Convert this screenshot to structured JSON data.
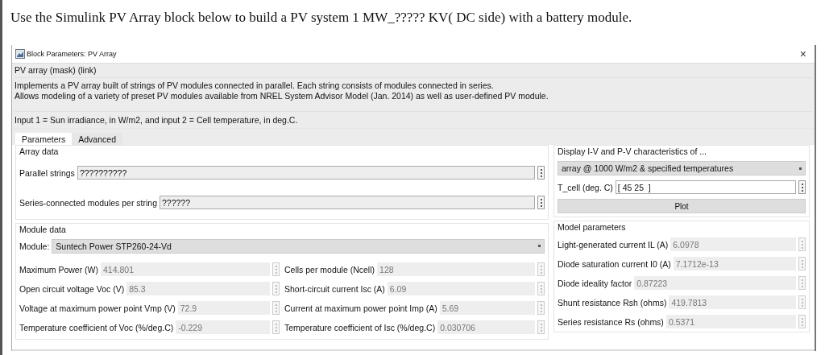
{
  "question": "Use the Simulink PV Array block below to build a PV system 1 MW_????? KV( DC side) with a battery module.",
  "dialog": {
    "title": "Block Parameters: PV Array",
    "close": "×",
    "mask_title": "PV array (mask) (link)",
    "description": [
      "Implements a PV array built of strings of PV modules connected in parallel. Each string consists of modules connected in series.",
      "Allows modeling of a variety of preset PV modules available from NREL System Advisor Model (Jan. 2014) as well as user-defined PV module."
    ],
    "input_note": "Input 1 = Sun irradiance, in W/m2, and input 2 = Cell temperature, in deg.C.",
    "tabs": [
      {
        "label": "Parameters",
        "selected": true
      },
      {
        "label": "Advanced",
        "selected": false
      }
    ],
    "array_data": {
      "title": "Array data",
      "fields": [
        {
          "label": "Parallel strings",
          "value": "??????????",
          "disabled": false
        },
        {
          "label": "Series-connected modules per string",
          "value": "??????",
          "disabled": false
        }
      ]
    },
    "module_data": {
      "title": "Module data",
      "module": {
        "label": "Module:",
        "value": "Suntech Power STP260-24-Vd"
      },
      "fields": [
        {
          "label": "Maximum Power (W)",
          "value": "414.801",
          "disabled": true
        },
        {
          "label": "Cells per module (Ncell)",
          "value": "128",
          "disabled": true
        },
        {
          "label": "Open circuit voltage  Voc (V)",
          "value": "85.3",
          "disabled": true
        },
        {
          "label": "Short-circuit current Isc (A)",
          "value": "6.09",
          "disabled": true
        },
        {
          "label": "Voltage at maximum power point Vmp (V)",
          "value": "72.9",
          "disabled": true
        },
        {
          "label": "Current at maximum power point Imp (A)",
          "value": "5.69",
          "disabled": true
        },
        {
          "label": "Temperature coefficient of Voc (%/deg.C)",
          "value": "-0.229",
          "disabled": true
        },
        {
          "label": "Temperature coefficient of Isc (%/deg.C)",
          "value": "0.030706",
          "disabled": true
        }
      ]
    },
    "display": {
      "title": "Display  I-V and P-V characteristics of ...",
      "dropdown": "array @ 1000 W/m2 & specified temperatures",
      "t_cell": {
        "label": "T_cell (deg. C)",
        "value": "[ 45 25  ]",
        "disabled": false
      },
      "plot_button": "Plot"
    },
    "model_parameters": {
      "title": "Model parameters",
      "fields": [
        {
          "label": "Light-generated current IL (A)",
          "value": "6.0978",
          "disabled": true
        },
        {
          "label": "Diode saturation current I0 (A)",
          "value": "7.1712e-13",
          "disabled": true
        },
        {
          "label": "Diode ideality factor",
          "value": "0.87223",
          "disabled": true
        },
        {
          "label": "Shunt resistance Rsh (ohms)",
          "value": "419.7813",
          "disabled": true
        },
        {
          "label": "Series resistance Rs (ohms)",
          "value": "0.5371",
          "disabled": true
        }
      ]
    }
  }
}
